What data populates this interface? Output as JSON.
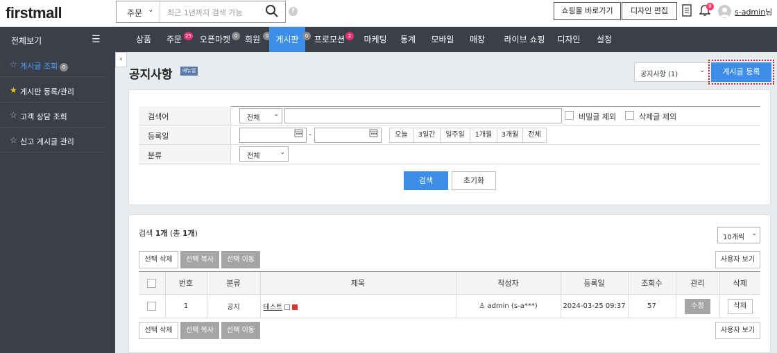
{
  "header": {
    "logo": "firstmall",
    "search_select": "주문",
    "search_placeholder": "최근 1년까지 검색 가능",
    "help_label": "?",
    "shop_button": "쇼핑몰 바로가기",
    "design_button": "디자인 편집",
    "notif_count": "8",
    "user_name": "s-admin",
    "user_suffix": "님"
  },
  "nav": {
    "allview": "전체보기",
    "items": [
      {
        "label": "상품",
        "badge": ""
      },
      {
        "label": "주문",
        "badge": "25"
      },
      {
        "label": "오픈마켓",
        "badge": "0"
      },
      {
        "label": "회원",
        "badge": "0"
      },
      {
        "label": "게시판",
        "badge": "0"
      },
      {
        "label": "프로모션",
        "badge": "2"
      },
      {
        "label": "마케팅",
        "badge": ""
      },
      {
        "label": "통계",
        "badge": ""
      },
      {
        "label": "모바일",
        "badge": ""
      },
      {
        "label": "매장",
        "badge": ""
      },
      {
        "label": "라이브 쇼핑",
        "badge": ""
      },
      {
        "label": "디자인",
        "badge": ""
      },
      {
        "label": "설정",
        "badge": ""
      }
    ]
  },
  "sidebar": {
    "items": [
      {
        "label": "게시글 조회",
        "badge": "0"
      },
      {
        "label": "게시판 등록/관리"
      },
      {
        "label": "고객 상담 조회"
      },
      {
        "label": "신고 게시글 관리"
      }
    ]
  },
  "page": {
    "title": "공지사항",
    "manual_badge": "매뉴얼",
    "board_select": "공지사항 (1)",
    "register_button": "게시글 등록"
  },
  "search": {
    "row1_label": "검색어",
    "row1_select": "전체",
    "secret_exclude": "비밀글 제외",
    "deleted_exclude": "삭제글 제외",
    "row2_label": "등록일",
    "date_sep": "-",
    "date_buttons": [
      "오늘",
      "3일간",
      "일주일",
      "1개월",
      "3개월",
      "전체"
    ],
    "row3_label": "분류",
    "row3_select": "전체",
    "search_button": "검색",
    "reset_button": "초기화"
  },
  "list": {
    "count_prefix": "검색 ",
    "count_value": "1개",
    "count_suffix": " (총 ",
    "total_value": "1개",
    "count_end": ")",
    "per_page": "10개씩",
    "delete_selected": "선택 삭제",
    "copy_selected": "선택 복사",
    "move_selected": "선택 이동",
    "user_view": "사용자 보기",
    "columns": [
      "번호",
      "분류",
      "제목",
      "작성자",
      "등록일",
      "조회수",
      "관리",
      "삭제"
    ],
    "rows": [
      {
        "no": "1",
        "category": "공지",
        "title": "테스트",
        "author": "admin (s-a***)",
        "date": "2024-03-25 09:37",
        "views": "57",
        "edit": "수정",
        "delete": "삭제"
      }
    ]
  }
}
